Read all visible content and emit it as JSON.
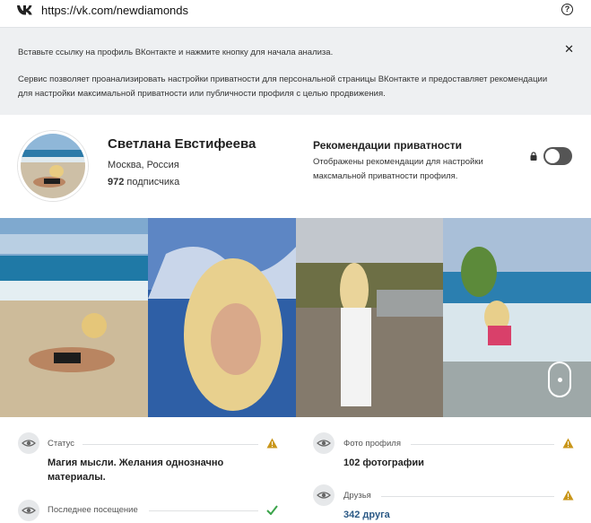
{
  "browser": {
    "url": "https://vk.com/newdiamonds",
    "icons": [
      "vk-logo-icon",
      "help-icon"
    ]
  },
  "info": {
    "line1": "Вставьте ссылку на профиль ВКонтакте и нажмите кнопку для начала анализа.",
    "line2": "Сервис позволяет проанализировать настройки приватности для персональной страницы ВКонтакте и предоставляет рекомендации для настройки максимальной приватности или публичности профиля с целью продвижения."
  },
  "profile": {
    "name": "Светлана Евстифеева",
    "city": "Москва, Россия",
    "followers_count": "972",
    "followers_label": " подписчика"
  },
  "privacy": {
    "title": "Рекомендации приватности",
    "description": "Отображены рекомендации для настройки максмальной приватности профиля.",
    "toggle_on": false
  },
  "stats": {
    "status": {
      "label": "Статус",
      "value": "Магия мысли. Желания однозначно материалы."
    },
    "last_visit": {
      "label": "Последнее посещение"
    },
    "photos": {
      "label": "Фото профиля",
      "value": "102 фотографии"
    },
    "friends": {
      "label": "Друзья",
      "value": "342 друга"
    }
  },
  "colors": {
    "accent_link": "#2a5885",
    "warning": "#c9961a",
    "ok": "#3aa34a",
    "info_bg": "#eef0f2"
  }
}
